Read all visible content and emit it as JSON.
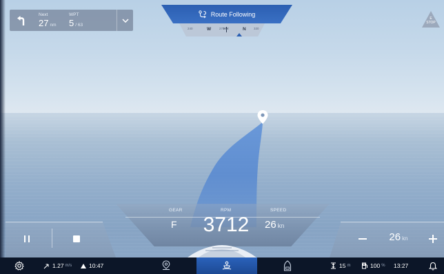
{
  "nav": {
    "next_label": "Next",
    "next_value": "27",
    "next_unit": "nm",
    "wpt_label": "WPT",
    "wpt_current": "5",
    "wpt_total": "/ 63"
  },
  "route": {
    "label": "Route Following"
  },
  "compass": {
    "marks": [
      "W",
      "NW",
      "N"
    ],
    "minor": [
      "240",
      "270",
      "300",
      "330",
      "30"
    ]
  },
  "estop": {
    "line1": "E",
    "line2": "STOP"
  },
  "hud": {
    "gear_label": "GEAR",
    "gear_value": "F",
    "rpm_label": "RPM",
    "rpm_value": "3712",
    "speed_label": "SPEED",
    "speed_value": "26",
    "speed_unit": "kn",
    "cruise_value": "26",
    "cruise_unit": "kn"
  },
  "statusbar": {
    "wind_value": "1.27",
    "wind_unit": "m/s",
    "heading_value": "10:47",
    "depth_value": "15",
    "depth_unit": "m",
    "fuel_value": "100",
    "fuel_unit": "%",
    "clock": "13:27"
  },
  "icons": {
    "turn": "turn-left-icon",
    "dropdown": "chevron-down-icon",
    "route": "route-icon",
    "estop": "warning-triangle-icon",
    "pin": "location-pin-icon",
    "settings": "gear-icon",
    "wind": "wind-icon",
    "heading": "triangle-up-icon",
    "map_tab": "map-pin-icon",
    "autopilot_tab": "autopilot-boat-icon",
    "boat_tab": "boat-icon",
    "depth": "depth-icon",
    "fuel": "fuel-icon",
    "notifications": "bell-icon"
  },
  "colors": {
    "accent": "#2b5fb2",
    "bar": "#0c1628",
    "path": "#4d82d1"
  }
}
